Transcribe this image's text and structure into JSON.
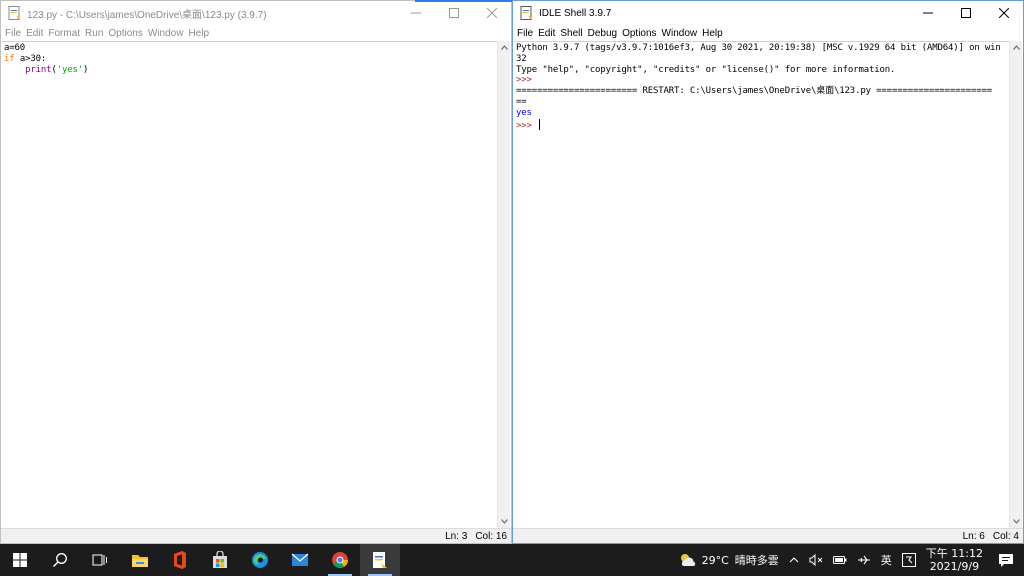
{
  "editor": {
    "title": "123.py - C:\\Users\\james\\OneDrive\\桌面\\123.py (3.9.7)",
    "menu": [
      "File",
      "Edit",
      "Format",
      "Run",
      "Options",
      "Window",
      "Help"
    ],
    "code": {
      "line1": "a=60",
      "line2_kw": "if",
      "line2_rest": " a>30:",
      "line3_indent": "    ",
      "line3_bi": "print",
      "line3_open": "(",
      "line3_str": "'yes'",
      "line3_close": ")"
    },
    "status": {
      "ln": "Ln: 3",
      "col": "Col: 16"
    }
  },
  "shell": {
    "title": "IDLE Shell 3.9.7",
    "menu": [
      "File",
      "Edit",
      "Shell",
      "Debug",
      "Options",
      "Window",
      "Help"
    ],
    "lines": {
      "banner1": "Python 3.9.7 (tags/v3.9.7:1016ef3, Aug 30 2021, 20:19:38) [MSC v.1929 64 bit (AMD64)] on win",
      "banner2": "32",
      "banner3": "Type \"help\", \"copyright\", \"credits\" or \"license()\" for more information.",
      "prompt1": ">>>",
      "restart1": "======================= RESTART: C:\\Users\\james\\OneDrive\\桌面\\123.py ======================",
      "restart2": "==",
      "output": "yes",
      "prompt2": ">>> "
    },
    "status": {
      "ln": "Ln: 6",
      "col": "Col: 4"
    }
  },
  "taskbar": {
    "weather": {
      "temp": "29°C",
      "desc": "晴時多雲"
    },
    "ime": "英",
    "clock": {
      "time": "下午 11:12",
      "date": "2021/9/9"
    }
  },
  "colors": {
    "keyword": "#ff7700",
    "builtin": "#900090",
    "string": "#00aa00",
    "output": "#0000ff",
    "prompt": "#a52a2a",
    "taskbar": "#1c1c1c"
  }
}
